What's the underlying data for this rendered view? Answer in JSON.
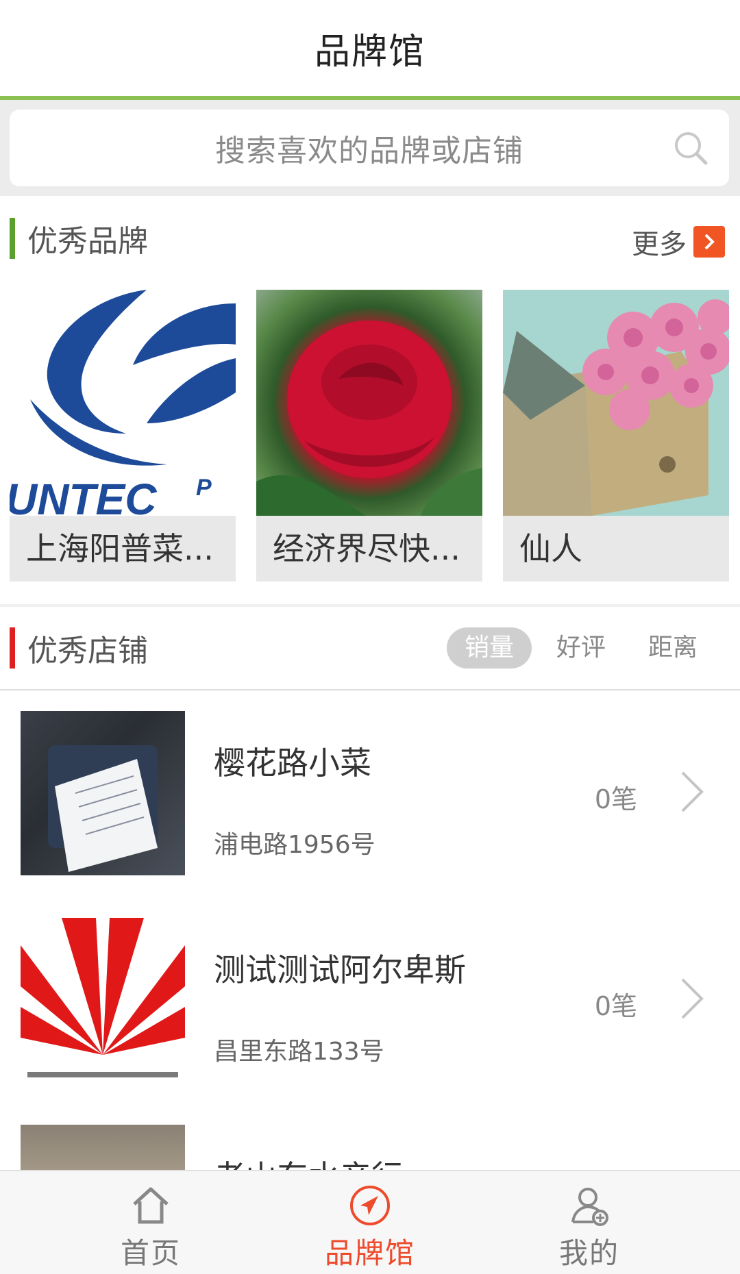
{
  "header": {
    "title": "品牌馆"
  },
  "search": {
    "placeholder": "搜索喜欢的品牌或店铺"
  },
  "brands": {
    "title": "优秀品牌",
    "more_label": "更多",
    "accent_color": "#5aa02c",
    "items": [
      {
        "name": "上海阳普菜...",
        "logo_text": "UNTEC",
        "logo_text_suffix": "P"
      },
      {
        "name": "经济界尽快..."
      },
      {
        "name": "仙人"
      }
    ]
  },
  "shops": {
    "title": "优秀店铺",
    "accent_color": "#e02020",
    "sort_tabs": [
      {
        "label": "销量",
        "active": true
      },
      {
        "label": "好评",
        "active": false
      },
      {
        "label": "距离",
        "active": false
      }
    ],
    "items": [
      {
        "name": "樱花路小菜",
        "address": "浦电路1956号",
        "sales": "0笔"
      },
      {
        "name": "测试测试阿尔卑斯",
        "address": "昌里东路133号",
        "sales": "0笔"
      },
      {
        "name": "老山东水产行",
        "address": "",
        "sales": ""
      }
    ]
  },
  "tabbar": {
    "active_color": "#ee4a2c",
    "items": [
      {
        "label": "首页",
        "icon": "home-icon"
      },
      {
        "label": "品牌馆",
        "icon": "compass-icon"
      },
      {
        "label": "我的",
        "icon": "user-icon"
      }
    ]
  }
}
